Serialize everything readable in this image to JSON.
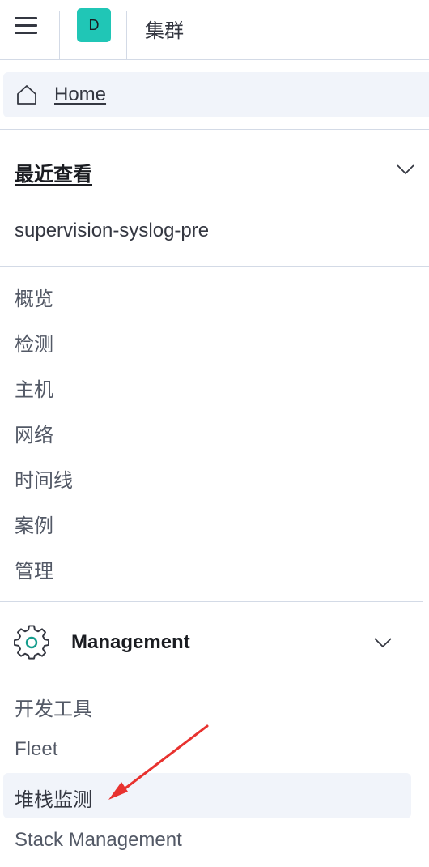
{
  "header": {
    "space_initial": "D",
    "breadcrumb": "集群"
  },
  "home": {
    "label": "Home"
  },
  "recent": {
    "title": "最近查看",
    "items": [
      "supervision-syslog-pre"
    ]
  },
  "security_nav": {
    "items": [
      "概览",
      "检测",
      "主机",
      "网络",
      "时间线",
      "案例",
      "管理"
    ]
  },
  "management": {
    "title": "Management",
    "items": [
      "开发工具",
      "Fleet",
      "堆栈监测",
      "Stack Management"
    ],
    "selected": "堆栈监测"
  },
  "colors": {
    "space_avatar": "#20c6b6",
    "selected_bg": "#f1f4fa",
    "annotation_arrow": "#e8322f",
    "gear_accent": "#159d8d"
  },
  "icons": [
    "menu-icon",
    "home-icon",
    "chevron-down-icon",
    "gear-icon"
  ]
}
